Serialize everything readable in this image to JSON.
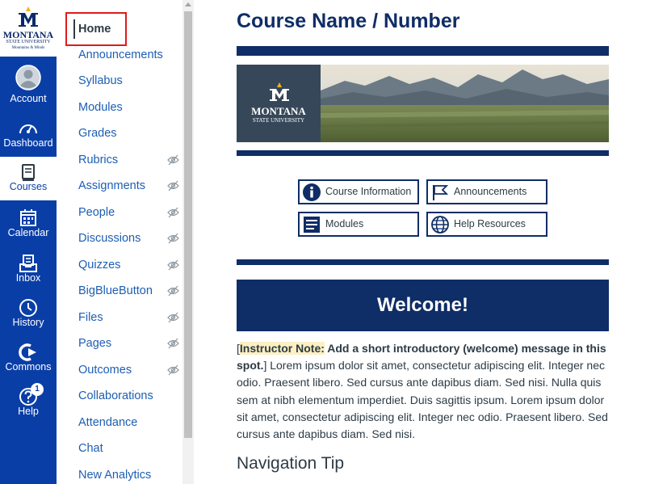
{
  "logo": {
    "name": "MONTANA",
    "sub": "STATE UNIVERSITY",
    "tag": "Mountains & Minds"
  },
  "global_nav": {
    "items": [
      {
        "label": "Account",
        "icon": "account-avatar-icon"
      },
      {
        "label": "Dashboard",
        "icon": "dashboard-gauge-icon"
      },
      {
        "label": "Courses",
        "icon": "courses-book-icon"
      },
      {
        "label": "Calendar",
        "icon": "calendar-icon"
      },
      {
        "label": "Inbox",
        "icon": "inbox-icon"
      },
      {
        "label": "History",
        "icon": "history-clock-icon"
      },
      {
        "label": "Commons",
        "icon": "commons-arrow-icon"
      },
      {
        "label": "Help",
        "icon": "help-question-icon"
      }
    ],
    "active": "Courses",
    "help_badge": "1"
  },
  "course_nav": {
    "items": [
      {
        "label": "Home"
      },
      {
        "label": "Announcements"
      },
      {
        "label": "Syllabus"
      },
      {
        "label": "Modules"
      },
      {
        "label": "Grades"
      },
      {
        "label": "Rubrics"
      },
      {
        "label": "Assignments"
      },
      {
        "label": "People"
      },
      {
        "label": "Discussions"
      },
      {
        "label": "Quizzes"
      },
      {
        "label": "BigBlueButton"
      },
      {
        "label": "Files"
      },
      {
        "label": "Pages"
      },
      {
        "label": "Outcomes"
      },
      {
        "label": "Collaborations"
      },
      {
        "label": "Attendance"
      },
      {
        "label": "Chat"
      },
      {
        "label": "New Analytics"
      }
    ]
  },
  "main": {
    "title": "Course Name / Number",
    "banner": {
      "name": "MONTANA",
      "sub": "STATE UNIVERSITY"
    },
    "buttons": {
      "course_information": "Course Information",
      "announcements": "Announcements",
      "modules": "Modules",
      "help_resources": "Help Resources"
    },
    "welcome": "Welcome!",
    "intro": {
      "open_bracket": "[",
      "note_label": "Instructor Note:",
      "note_msg": " Add a short introductory (welcome) message in this spot.",
      "close_bracket": "]",
      "body": " Lorem ipsum dolor sit amet, consectetur adipiscing elit. Integer nec odio. Praesent libero. Sed cursus ante dapibus diam. Sed nisi. Nulla quis sem at nibh elementum imperdiet. Duis sagittis ipsum. Lorem ipsum dolor sit amet, consectetur adipiscing elit. Integer nec odio. Praesent libero. Sed cursus ante dapibus diam. Sed nisi."
    },
    "nav_tip_heading": "Navigation Tip"
  },
  "colors": {
    "global_nav_bg": "#0a3ea7",
    "brand_navy": "#0f2d66",
    "link_blue": "#1d5eb3",
    "highlight_box": "#e01b1b",
    "note_highlight": "#fcf0c3"
  }
}
